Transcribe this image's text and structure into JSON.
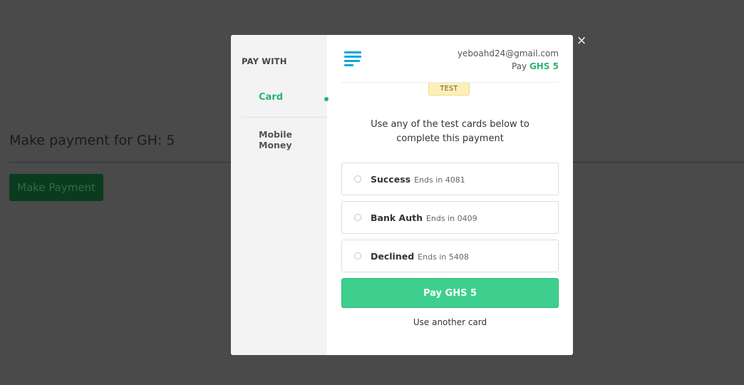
{
  "background_page": {
    "title": "Make payment for GH: 5",
    "button_label": "Make Payment"
  },
  "modal": {
    "sidebar": {
      "heading": "PAY WITH",
      "methods": [
        {
          "label": "Card",
          "active": true
        },
        {
          "label": "Mobile Money",
          "active": false
        }
      ]
    },
    "header": {
      "logo_icon": "paystack-stripes-icon",
      "email": "yeboahd24@gmail.com",
      "pay_prefix": "Pay",
      "pay_amount": "GHS 5"
    },
    "test_badge": "TEST",
    "instructions": [
      "Use any of the test cards below to",
      "complete this payment"
    ],
    "test_cards": [
      {
        "name": "Success",
        "ends": "Ends in 4081"
      },
      {
        "name": "Bank Auth",
        "ends": "Ends in 0409"
      },
      {
        "name": "Declined",
        "ends": "Ends in 5408"
      }
    ],
    "pay_button": "Pay GHS 5",
    "another_card": "Use another card",
    "close_glyph": "×"
  },
  "colors": {
    "accent_green": "#29b473",
    "pay_button": "#3ecf8e",
    "logo_blue": "#0ea8d8",
    "overlay": "#4a4a4a"
  }
}
